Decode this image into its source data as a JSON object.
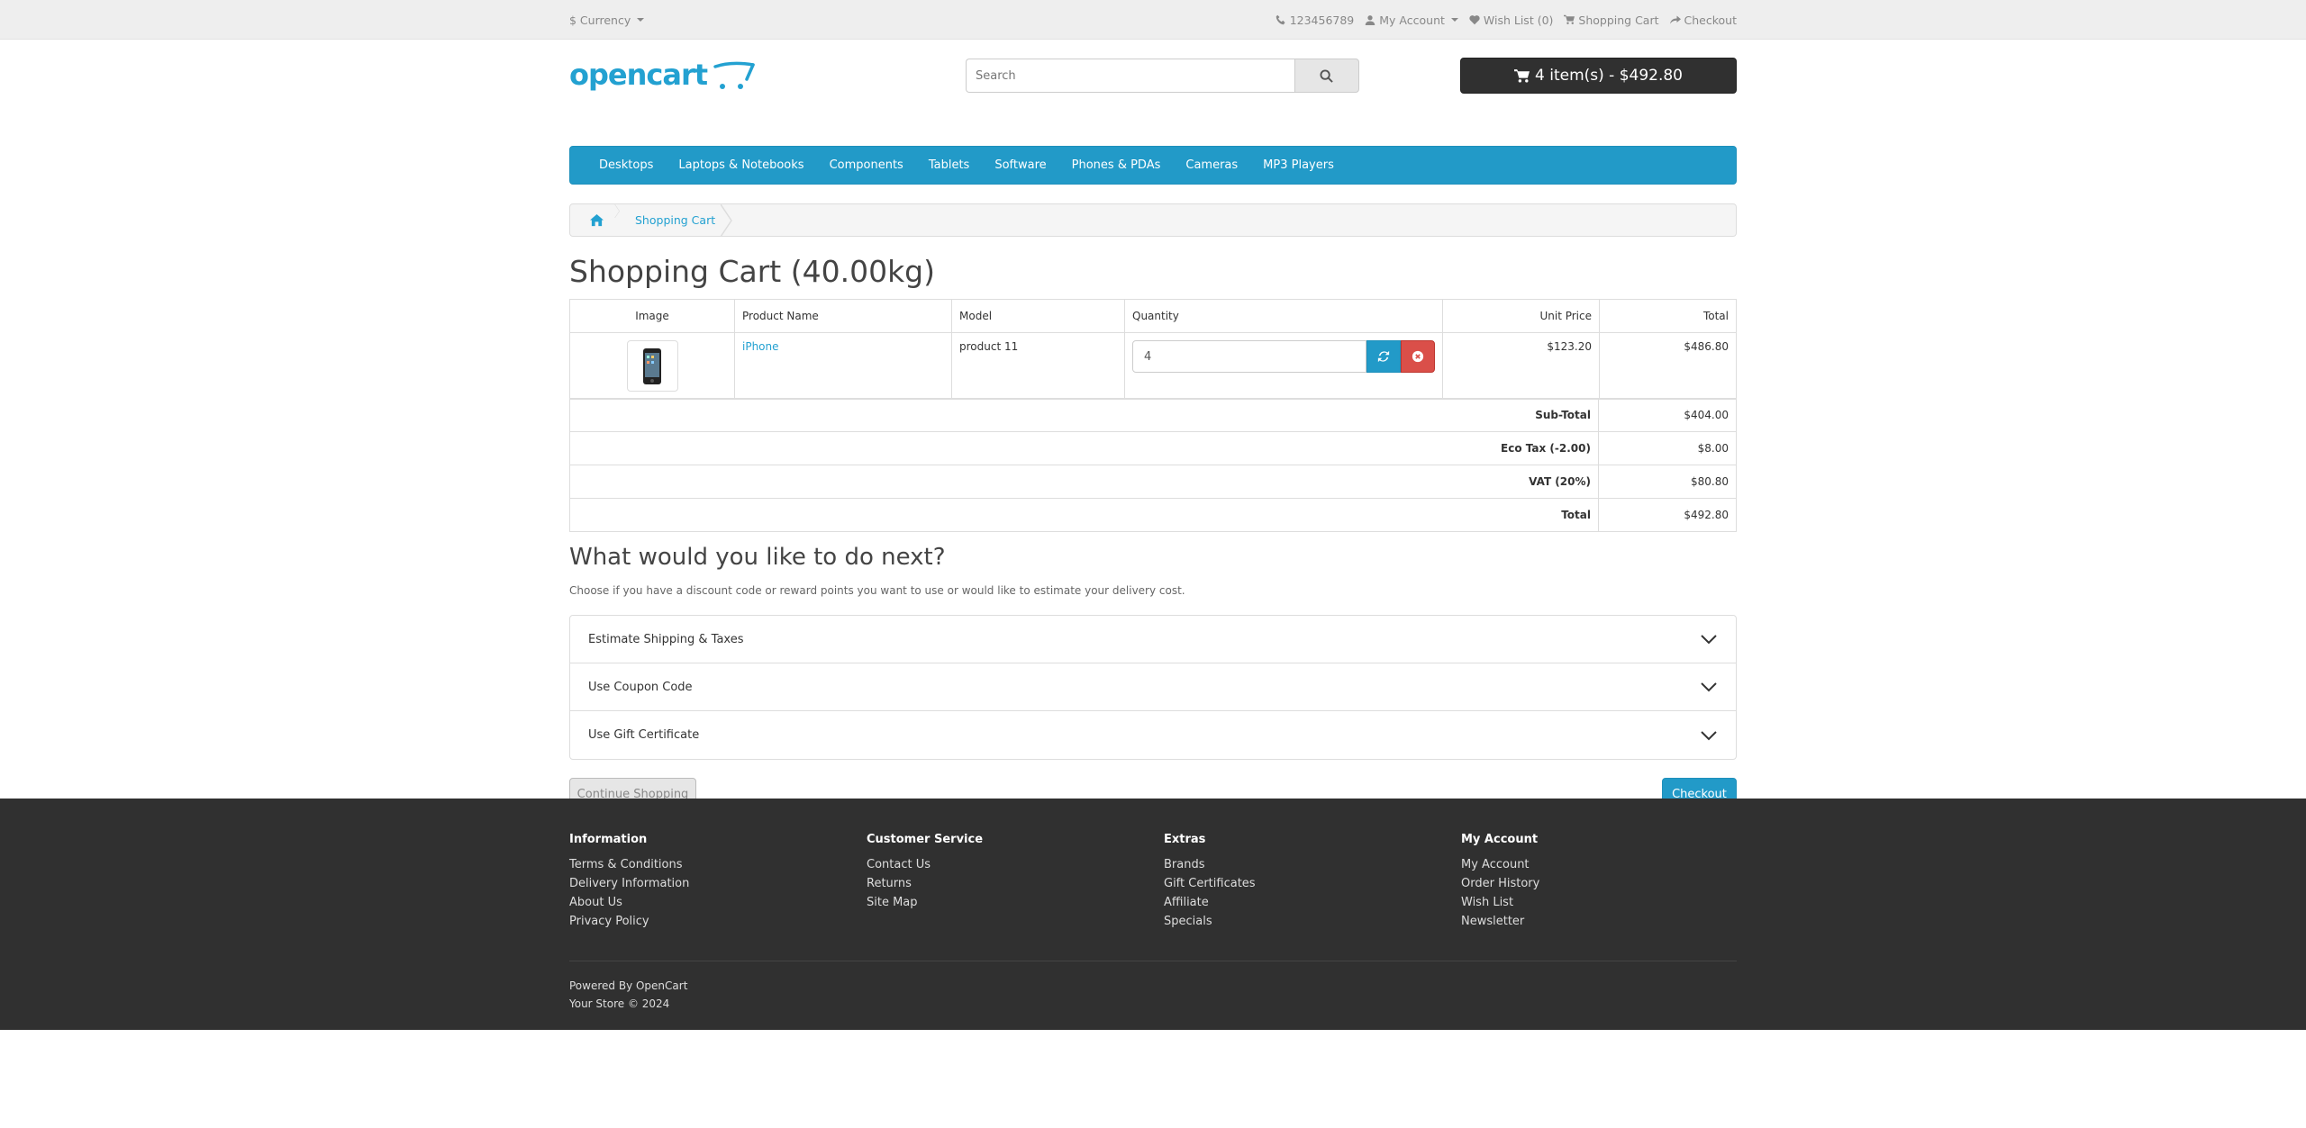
{
  "topbar": {
    "currency": "$ Currency",
    "phone": "123456789",
    "my_account": "My Account",
    "wish_list": "Wish List (0)",
    "shopping_cart": "Shopping Cart",
    "checkout": "Checkout"
  },
  "header": {
    "logo_text": "opencart",
    "search_placeholder": "Search",
    "cart_button": "4 item(s) - $492.80"
  },
  "menu": [
    "Desktops",
    "Laptops & Notebooks",
    "Components",
    "Tablets",
    "Software",
    "Phones & PDAs",
    "Cameras",
    "MP3 Players"
  ],
  "breadcrumb": {
    "current": "Shopping Cart"
  },
  "page_title": "Shopping Cart (40.00kg)",
  "cart_table": {
    "headers": {
      "image": "Image",
      "name": "Product Name",
      "model": "Model",
      "quantity": "Quantity",
      "unit_price": "Unit Price",
      "total": "Total"
    },
    "row": {
      "name": "iPhone",
      "model": "product 11",
      "quantity": "4",
      "unit_price": "$123.20",
      "total": "$486.80"
    }
  },
  "totals": [
    {
      "label": "Sub-Total",
      "value": "$404.00"
    },
    {
      "label": "Eco Tax (-2.00)",
      "value": "$8.00"
    },
    {
      "label": "VAT (20%)",
      "value": "$80.80"
    },
    {
      "label": "Total",
      "value": "$492.80"
    }
  ],
  "next": {
    "title": "What would you like to do next?",
    "description": "Choose if you have a discount code or reward points you want to use or would like to estimate your delivery cost.",
    "panels": [
      "Estimate Shipping & Taxes",
      "Use Coupon Code",
      "Use Gift Certificate"
    ]
  },
  "buttons": {
    "continue": "Continue Shopping",
    "checkout": "Checkout"
  },
  "footer": {
    "information": {
      "title": "Information",
      "links": [
        "Terms & Conditions",
        "Delivery Information",
        "About Us",
        "Privacy Policy"
      ]
    },
    "customer_service": {
      "title": "Customer Service",
      "links": [
        "Contact Us",
        "Returns",
        "Site Map"
      ]
    },
    "extras": {
      "title": "Extras",
      "links": [
        "Brands",
        "Gift Certificates",
        "Affiliate",
        "Specials"
      ]
    },
    "my_account": {
      "title": "My Account",
      "links": [
        "My Account",
        "Order History",
        "Wish List",
        "Newsletter"
      ]
    },
    "powered_prefix": "Powered By ",
    "powered_link": "OpenCart",
    "copyright": "Your Store © 2024"
  },
  "colors": {
    "accent": "#229ac8",
    "dark": "#303030",
    "danger": "#da4f49"
  }
}
